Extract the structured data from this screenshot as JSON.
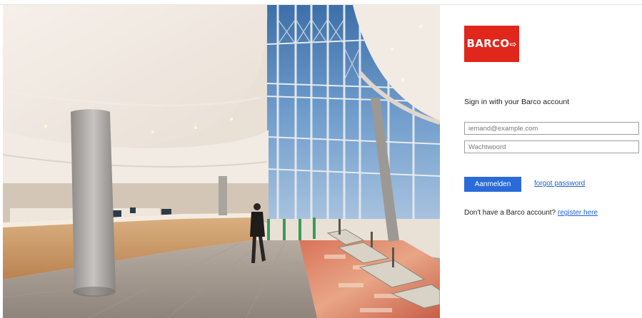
{
  "hero": {
    "image_description": "hero-photo",
    "colors": {
      "sky": "#5b8ec4",
      "wood": "#c89664",
      "wall": "#efe9e3"
    }
  },
  "brand": {
    "logo_text": "BARCO",
    "logo_arrow": "⇨",
    "logo_color": "#e1261c"
  },
  "login": {
    "heading": "Sign in with your Barco account",
    "email_placeholder": "iemand@example.com",
    "password_placeholder": "Wachtwoord",
    "signin_label": "Aanmelden",
    "forgot_label": "forgot password",
    "no_account_text": "Don't have a Barco account?",
    "register_label": "register here",
    "accent_color": "#2a6bd9",
    "link_color": "#1f5fd6"
  }
}
